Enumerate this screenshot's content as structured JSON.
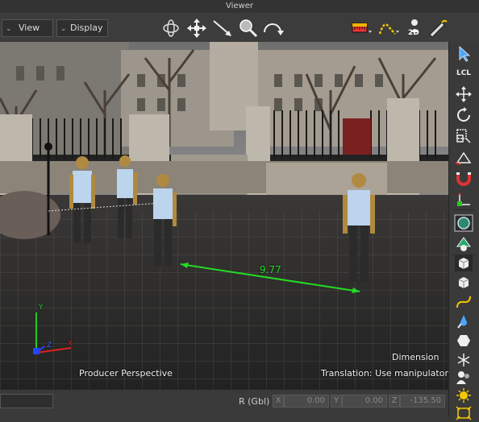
{
  "window": {
    "title": "Viewer"
  },
  "toolbar": {
    "view_menu": "View",
    "display_menu": "Display",
    "icons": [
      "orbit-icon",
      "pan-icon",
      "dolly-icon",
      "zoom-icon",
      "undo-view-icon",
      "ruler-icon",
      "path-icon",
      "2d-view-icon",
      "pen-icon"
    ],
    "twod_label": "2D"
  },
  "viewport": {
    "dimension_value": "9.77",
    "camera_label": "Producer Perspective",
    "tool_label": "Dimension",
    "hint_label": "Translation: Use manipulator",
    "gizmo": {
      "x": "X",
      "y": "Y",
      "z": "Z"
    },
    "dimension_color": "#22dd22"
  },
  "right_toolbar": {
    "lcl_label": "LCL",
    "icons": [
      "select-icon",
      "local-icon",
      "move-icon",
      "rotate-icon",
      "scale-icon",
      "triangle-icon",
      "magnet-icon",
      "pivot-icon",
      "globe-icon",
      "sphere-icon",
      "cube-icon",
      "cube-alt-icon",
      "spline-icon",
      "drop-icon",
      "hexagon-icon",
      "asterisk-icon",
      "people-icon",
      "sun-icon",
      "frame-icon"
    ]
  },
  "status": {
    "rotation_label": "R (Gbl)",
    "x_label": "X",
    "x_value": "0.00",
    "y_label": "Y",
    "y_value": "0.00",
    "z_label": "Z",
    "z_value": "-135.50"
  }
}
